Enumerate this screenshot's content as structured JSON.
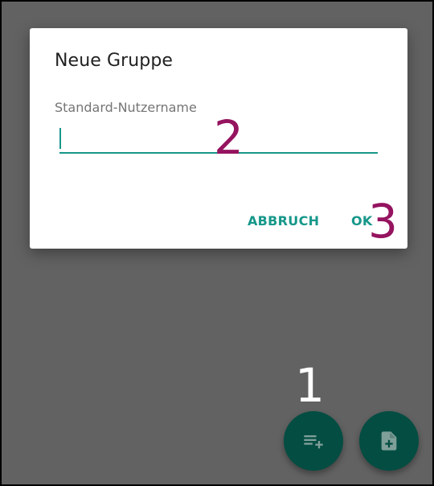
{
  "dialog": {
    "title": "Neue Gruppe",
    "field_label": "Standard-Nutzername",
    "field_value": "",
    "cancel_label": "ABBRUCH",
    "ok_label": "OK"
  },
  "annotations": {
    "one": "1",
    "two": "2",
    "three": "3"
  },
  "fabs": {
    "add_group_icon": "playlist-add-icon",
    "add_document_icon": "note-add-icon"
  },
  "colors": {
    "accent": "#16978a",
    "fab": "#034d42",
    "annotation": "#95135f",
    "scrim": "#626262"
  }
}
